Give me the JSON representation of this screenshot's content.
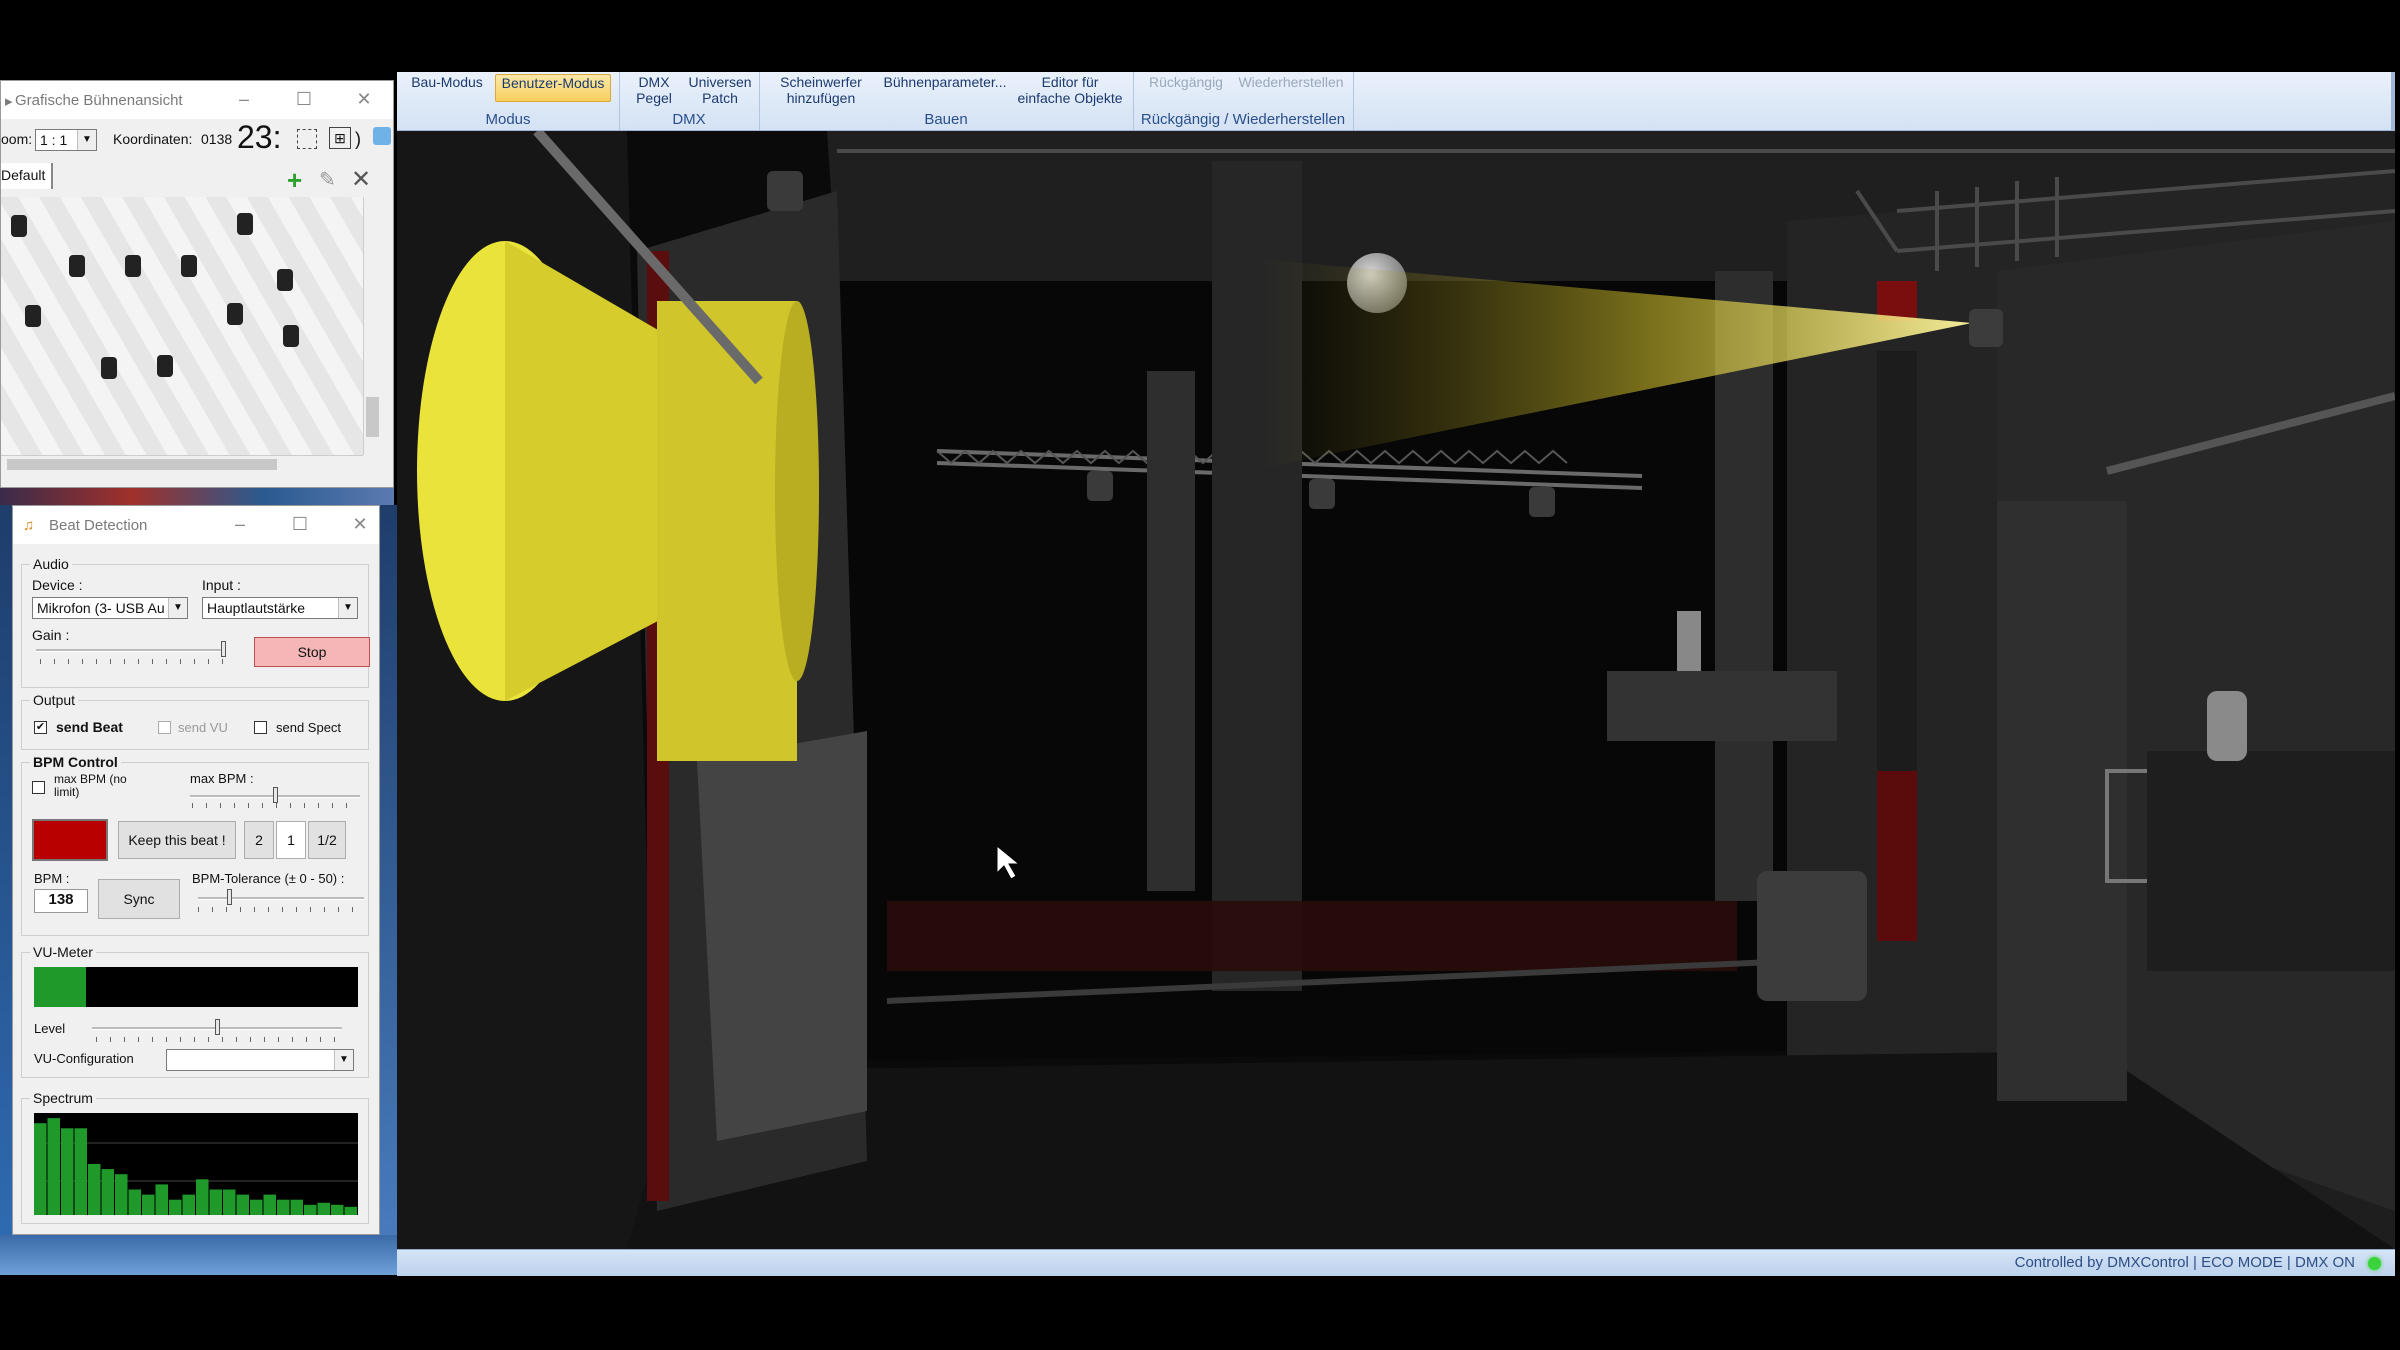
{
  "ribbon": {
    "groups": [
      {
        "label": "Modus",
        "buttons": [
          "Bau-Modus",
          "Benutzer-Modus"
        ]
      },
      {
        "label": "DMX",
        "buttons": [
          "DMX\nPegel",
          "Universen\nPatch"
        ]
      },
      {
        "label": "Bauen",
        "buttons": [
          "Scheinwerfer\nhinzufügen",
          "Bühnenparameter...",
          "Editor für\neinfache Objekte"
        ]
      },
      {
        "label": "Rückgängig / Wiederherstellen",
        "buttons": [
          "Rückgängig",
          "Wiederherstellen"
        ]
      }
    ]
  },
  "status": {
    "text": "Controlled by DMXControl  |  ECO MODE  |  DMX ON",
    "led_color": "#3bd33b"
  },
  "stage_window": {
    "title": "Grafische Bühnenansicht",
    "zoom_label": "oom:",
    "zoom_value": "1 : 1",
    "coord_label": "Koordinaten:",
    "coord_value": "0138",
    "big_value": "23:",
    "layer": "Default",
    "icons": [
      "add-icon",
      "edit-icon",
      "delete-icon"
    ]
  },
  "beat_window": {
    "title": "Beat Detection",
    "audio": {
      "legend": "Audio",
      "device_label": "Device :",
      "device_value": "Mikrofon (3- USB Au",
      "input_label": "Input :",
      "input_value": "Hauptlautstärke",
      "gain_label": "Gain :",
      "gain_level": 1.0,
      "stop_label": "Stop"
    },
    "output": {
      "legend": "Output",
      "send_beat": "send Beat",
      "send_beat_checked": true,
      "send_vu": "send VU",
      "send_vu_checked": false,
      "send_spect": "send Spect",
      "send_spect_checked": false
    },
    "bpm": {
      "legend": "BPM Control",
      "max_bpm_nolimit": "max BPM (no limit)",
      "max_bpm_label": "max BPM :",
      "max_bpm_level": 0.5,
      "keep_label": "Keep this beat !",
      "mult": [
        "2",
        "1",
        "1/2"
      ],
      "bpm_label": "BPM :",
      "bpm_value": "138",
      "sync_label": "Sync",
      "tolerance_label": "BPM-Tolerance (± 0 - 50) :",
      "tolerance_level": 0.18,
      "beat_indicator_color": "#b80000"
    },
    "vu": {
      "legend": "VU-Meter",
      "level_value": 0.16,
      "level_label": "Level",
      "slider_level": 0.5,
      "config_label": "VU-Configuration",
      "config_value": ""
    },
    "spectrum": {
      "legend": "Spectrum",
      "bars": [
        0.9,
        0.95,
        0.85,
        0.85,
        0.5,
        0.45,
        0.4,
        0.25,
        0.2,
        0.3,
        0.15,
        0.2,
        0.35,
        0.25,
        0.25,
        0.2,
        0.15,
        0.2,
        0.15,
        0.15,
        0.1,
        0.12,
        0.1,
        0.08
      ]
    }
  }
}
